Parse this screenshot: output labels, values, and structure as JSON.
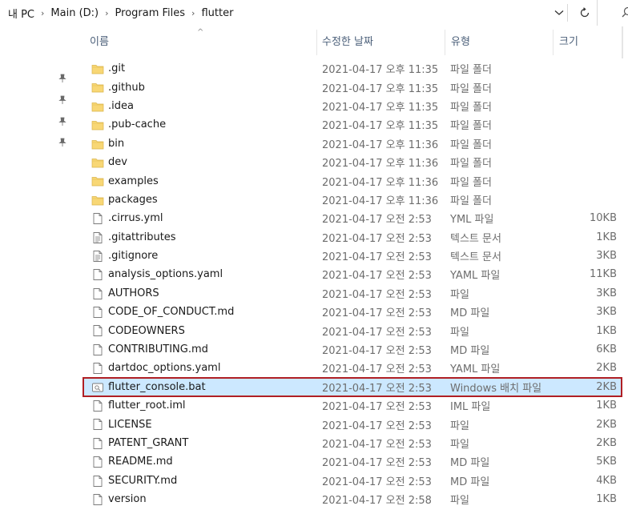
{
  "address_bar": {
    "crumbs": [
      "내 PC",
      "Main (D:)",
      "Program Files",
      "flutter"
    ]
  },
  "columns": {
    "name": "이름",
    "date": "수정한 날짜",
    "type": "유형",
    "size": "크기"
  },
  "files": [
    {
      "name": ".git",
      "date": "2021-04-17 오후 11:35",
      "type": "파일 폴더",
      "size": "",
      "icon": "folder-icon"
    },
    {
      "name": ".github",
      "date": "2021-04-17 오후 11:35",
      "type": "파일 폴더",
      "size": "",
      "icon": "folder-icon"
    },
    {
      "name": ".idea",
      "date": "2021-04-17 오후 11:35",
      "type": "파일 폴더",
      "size": "",
      "icon": "folder-icon"
    },
    {
      "name": ".pub-cache",
      "date": "2021-04-17 오후 11:35",
      "type": "파일 폴더",
      "size": "",
      "icon": "folder-icon"
    },
    {
      "name": "bin",
      "date": "2021-04-17 오후 11:36",
      "type": "파일 폴더",
      "size": "",
      "icon": "folder-icon"
    },
    {
      "name": "dev",
      "date": "2021-04-17 오후 11:36",
      "type": "파일 폴더",
      "size": "",
      "icon": "folder-icon"
    },
    {
      "name": "examples",
      "date": "2021-04-17 오후 11:36",
      "type": "파일 폴더",
      "size": "",
      "icon": "folder-icon"
    },
    {
      "name": "packages",
      "date": "2021-04-17 오후 11:36",
      "type": "파일 폴더",
      "size": "",
      "icon": "folder-icon"
    },
    {
      "name": ".cirrus.yml",
      "date": "2021-04-17 오전 2:53",
      "type": "YML 파일",
      "size": "10KB",
      "icon": "file-icon"
    },
    {
      "name": ".gitattributes",
      "date": "2021-04-17 오전 2:53",
      "type": "텍스트 문서",
      "size": "1KB",
      "icon": "text-file-icon"
    },
    {
      "name": ".gitignore",
      "date": "2021-04-17 오전 2:53",
      "type": "텍스트 문서",
      "size": "3KB",
      "icon": "text-file-icon"
    },
    {
      "name": "analysis_options.yaml",
      "date": "2021-04-17 오전 2:53",
      "type": "YAML 파일",
      "size": "11KB",
      "icon": "file-icon"
    },
    {
      "name": "AUTHORS",
      "date": "2021-04-17 오전 2:53",
      "type": "파일",
      "size": "3KB",
      "icon": "file-icon"
    },
    {
      "name": "CODE_OF_CONDUCT.md",
      "date": "2021-04-17 오전 2:53",
      "type": "MD 파일",
      "size": "3KB",
      "icon": "file-icon"
    },
    {
      "name": "CODEOWNERS",
      "date": "2021-04-17 오전 2:53",
      "type": "파일",
      "size": "1KB",
      "icon": "file-icon"
    },
    {
      "name": "CONTRIBUTING.md",
      "date": "2021-04-17 오전 2:53",
      "type": "MD 파일",
      "size": "6KB",
      "icon": "file-icon"
    },
    {
      "name": "dartdoc_options.yaml",
      "date": "2021-04-17 오전 2:53",
      "type": "YAML 파일",
      "size": "2KB",
      "icon": "file-icon"
    },
    {
      "name": "flutter_console.bat",
      "date": "2021-04-17 오전 2:53",
      "type": "Windows 배치 파일",
      "size": "2KB",
      "icon": "batch-file-icon",
      "selected": true
    },
    {
      "name": "flutter_root.iml",
      "date": "2021-04-17 오전 2:53",
      "type": "IML 파일",
      "size": "1KB",
      "icon": "file-icon"
    },
    {
      "name": "LICENSE",
      "date": "2021-04-17 오전 2:53",
      "type": "파일",
      "size": "2KB",
      "icon": "file-icon"
    },
    {
      "name": "PATENT_GRANT",
      "date": "2021-04-17 오전 2:53",
      "type": "파일",
      "size": "2KB",
      "icon": "file-icon"
    },
    {
      "name": "README.md",
      "date": "2021-04-17 오전 2:53",
      "type": "MD 파일",
      "size": "5KB",
      "icon": "file-icon"
    },
    {
      "name": "SECURITY.md",
      "date": "2021-04-17 오전 2:53",
      "type": "MD 파일",
      "size": "4KB",
      "icon": "file-icon"
    },
    {
      "name": "version",
      "date": "2021-04-17 오전 2:58",
      "type": "파일",
      "size": "1KB",
      "icon": "file-icon"
    }
  ],
  "colors": {
    "folder": "#f8d775",
    "selection_bg": "#cce8ff",
    "selection_outline": "#b01f24",
    "header_text": "#4c607a",
    "detail_text": "#6d6d6d"
  }
}
